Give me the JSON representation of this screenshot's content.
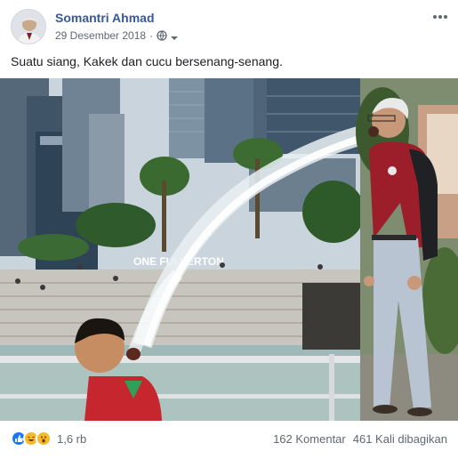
{
  "post": {
    "author": "Somantri Ahmad",
    "date": "29 Desember 2018",
    "separator": "·",
    "caption": "Suatu siang, Kakek dan cucu bersenang-senang."
  },
  "photo": {
    "sign_text": "ONE FULLERTON"
  },
  "footer": {
    "reaction_count": "1,6 rb",
    "comments": "162 Komentar",
    "shares": "461 Kali dibagikan"
  },
  "colors": {
    "author_link": "#385898",
    "like_blue": "#1877f2",
    "haha_yellow": "#f7b928",
    "meta_gray": "#606770"
  }
}
